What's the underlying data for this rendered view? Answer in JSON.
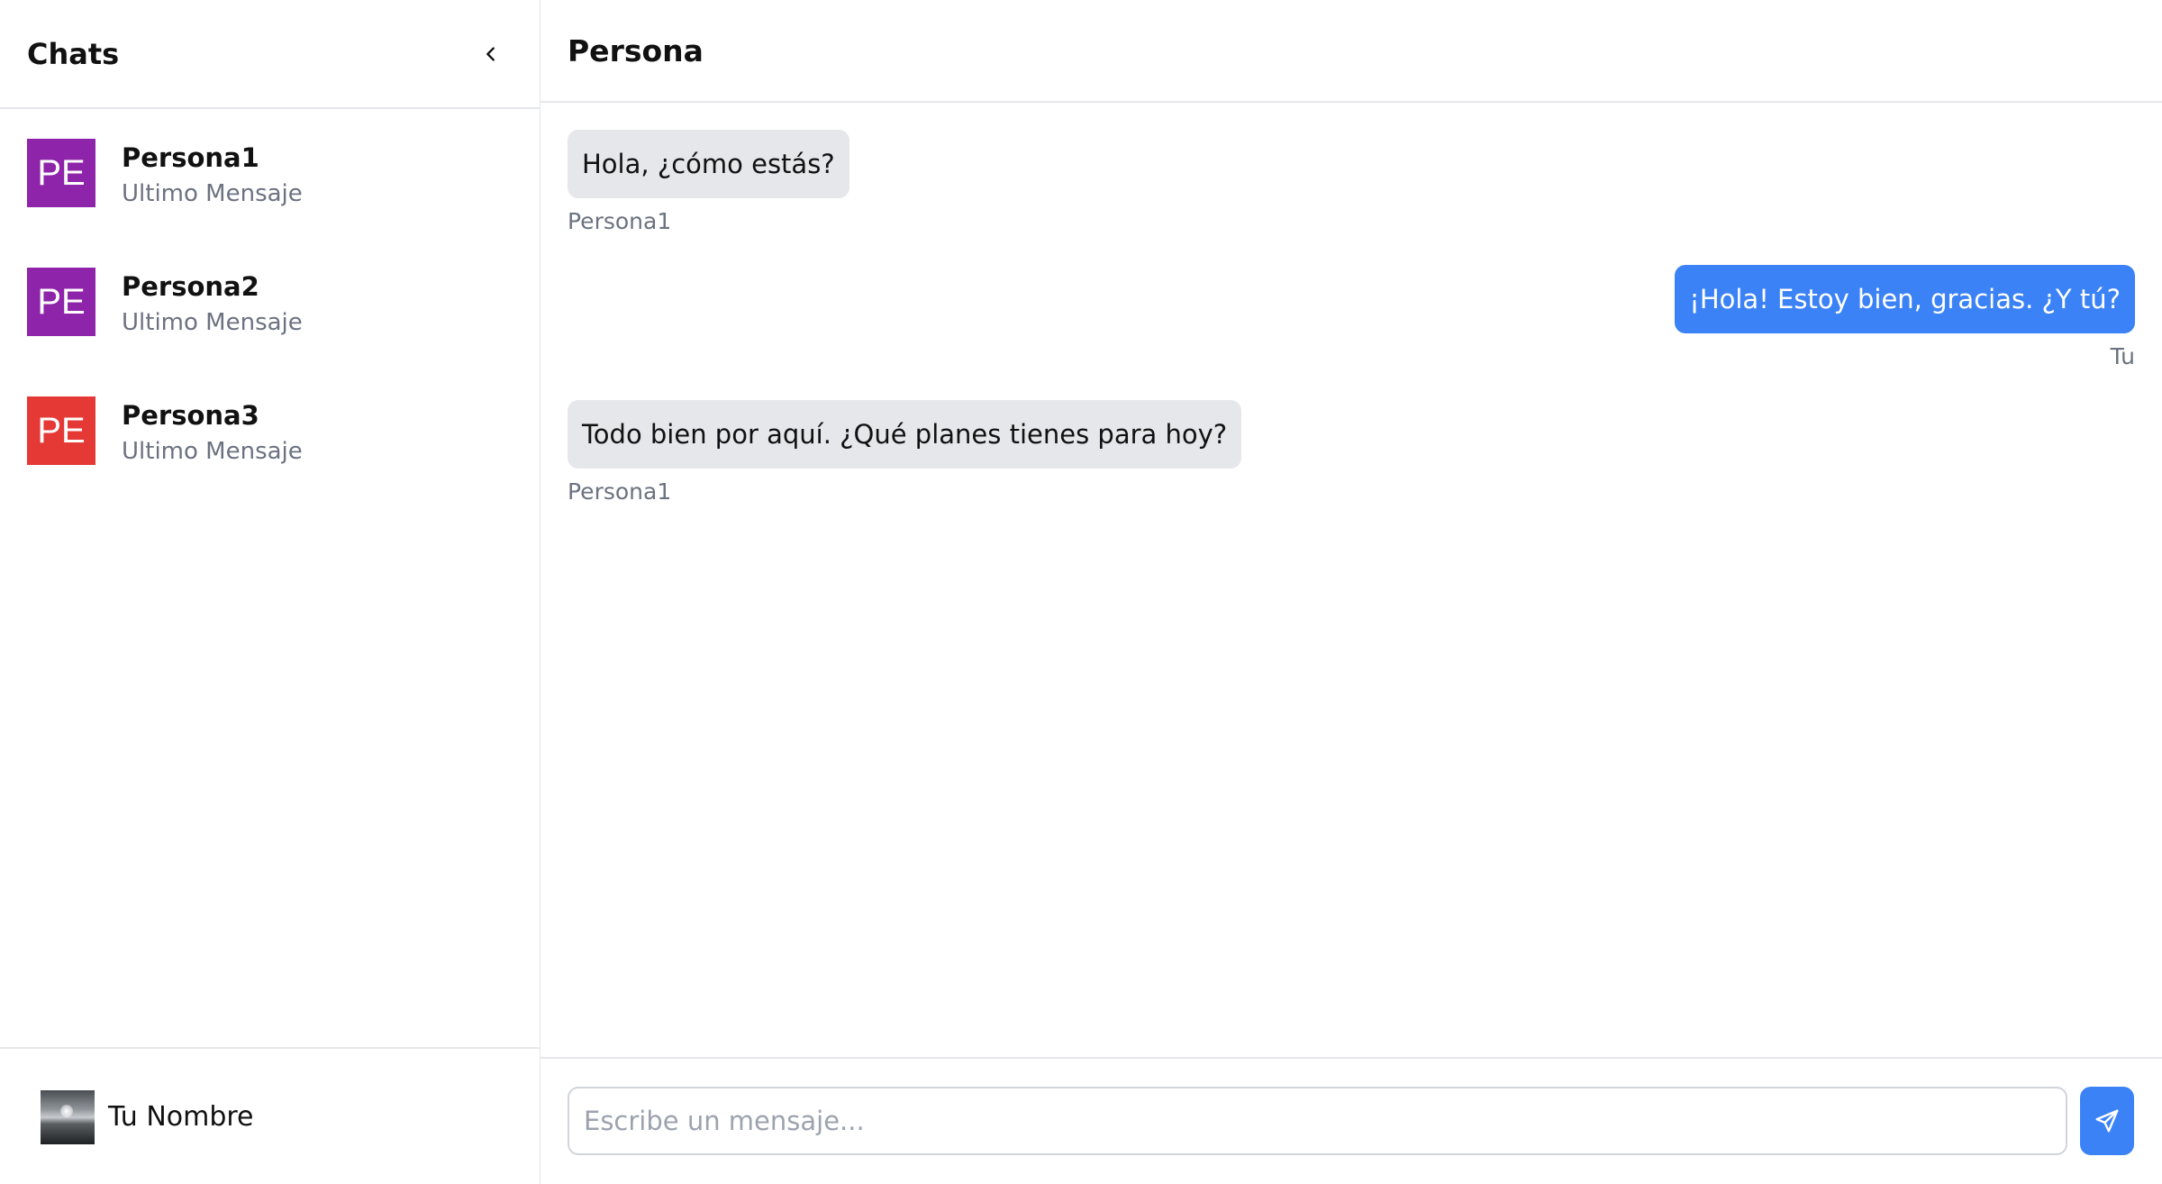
{
  "sidebar": {
    "title": "Chats",
    "collapse_icon": "chevron-left-icon",
    "chats": [
      {
        "initials": "PE",
        "name": "Persona1",
        "last_message": "Ultimo Mensaje",
        "color": "#8e24aa"
      },
      {
        "initials": "PE",
        "name": "Persona2",
        "last_message": "Ultimo Mensaje",
        "color": "#8e24aa"
      },
      {
        "initials": "PE",
        "name": "Persona3",
        "last_message": "Ultimo Mensaje",
        "color": "#e53935"
      }
    ],
    "user": {
      "name": "Tu Nombre"
    }
  },
  "conversation": {
    "title": "Persona",
    "messages": [
      {
        "text": "Hola, ¿cómo estás?",
        "sender": "Persona1",
        "direction": "incoming"
      },
      {
        "text": "¡Hola! Estoy bien, gracias. ¿Y tú?",
        "sender": "Tu",
        "direction": "outgoing"
      },
      {
        "text": "Todo bien por aquí. ¿Qué planes tienes para hoy?",
        "sender": "Persona1",
        "direction": "incoming"
      }
    ]
  },
  "composer": {
    "placeholder": "Escribe un mensaje...",
    "value": "",
    "send_icon": "send-icon"
  },
  "colors": {
    "accent": "#3b82f6",
    "incoming_bubble": "#e5e7eb",
    "muted_text": "#6b7280",
    "divider": "#e5e7eb"
  }
}
